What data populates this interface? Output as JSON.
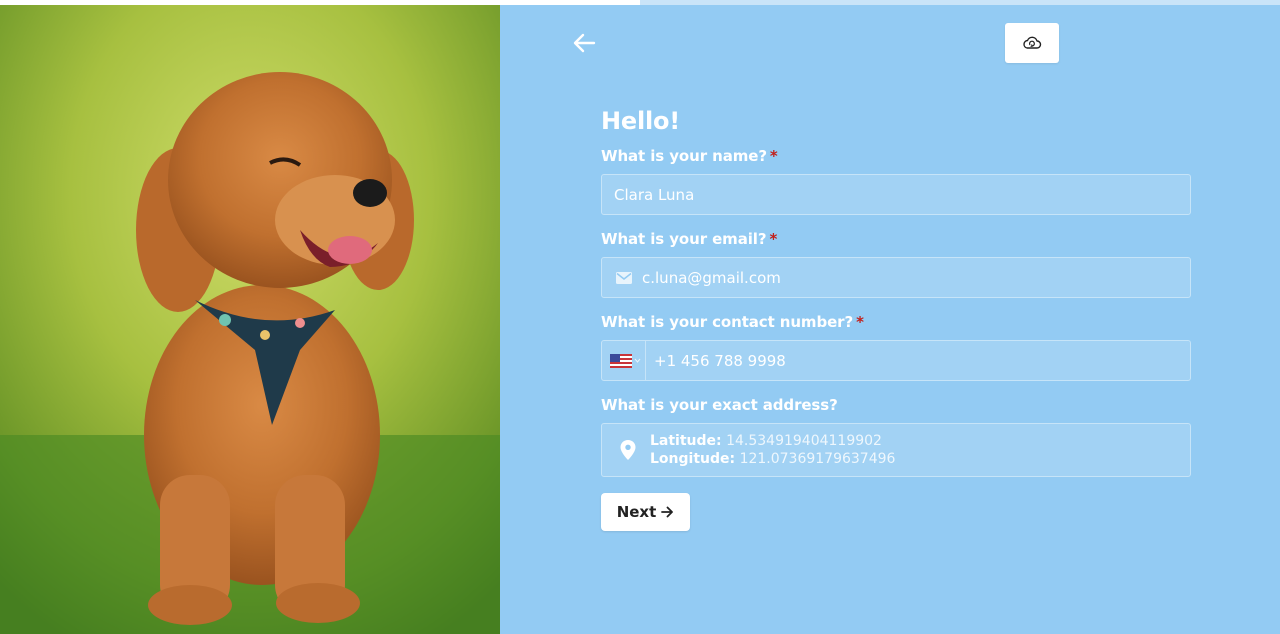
{
  "progress": {
    "fraction": 0.5
  },
  "photo": {
    "subject": "poodle-dog-photo"
  },
  "toolbar": {
    "back_icon": "arrow-left-icon",
    "save_icon": "cloud-sync-icon"
  },
  "form": {
    "title": "Hello!",
    "name": {
      "label": "What is your name?",
      "required": "*",
      "value": "Clara Luna"
    },
    "email": {
      "label": "What is your email?",
      "required": "*",
      "value": "c.luna@gmail.com",
      "icon": "mail-icon"
    },
    "phone": {
      "label": "What is your contact number?",
      "required": "*",
      "country": "us-flag-icon",
      "value": "+1 456 788 9998"
    },
    "address": {
      "label": "What is your exact address?",
      "icon": "location-pin-icon",
      "latitude_label": "Latitude:",
      "latitude_value": "14.534919404119902",
      "longitude_label": "Longitude:",
      "longitude_value": "121.07369179637496"
    },
    "next_label": "Next"
  },
  "colors": {
    "background": "#93cbf3",
    "required": "#c2201b",
    "button_bg": "#ffffff"
  }
}
